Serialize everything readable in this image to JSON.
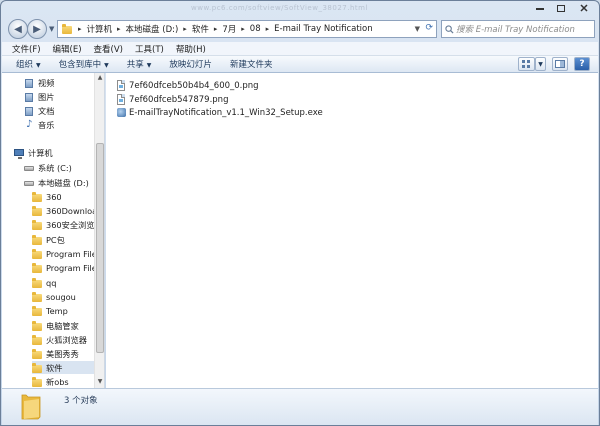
{
  "watermark": "www.pc6.com/softview/SoftView_38027.html",
  "address": {
    "crumbs": [
      "计算机",
      "本地磁盘 (D:)",
      "软件",
      "7月",
      "08",
      "E-mail Tray Notification"
    ],
    "separator": "▸"
  },
  "search": {
    "placeholder": "搜索 E-mail Tray Notification"
  },
  "menu": [
    "文件(F)",
    "编辑(E)",
    "查看(V)",
    "工具(T)",
    "帮助(H)"
  ],
  "toolbar": {
    "organize": "组织",
    "include": "包含到库中",
    "share": "共享",
    "slideshow": "放映幻灯片",
    "new_folder": "新建文件夹"
  },
  "nav": {
    "libraries": [
      "视频",
      "图片",
      "文档",
      "音乐"
    ],
    "computer": "计算机",
    "drives": [
      "系统 (C:)",
      "本地磁盘 (D:)"
    ],
    "folders": [
      "360",
      "360Download",
      "360安全浏览器",
      "PC包",
      "Program Files",
      "Program Files",
      "qq",
      "sougou",
      "Temp",
      "电脑管家",
      "火狐浏览器",
      "美图秀秀",
      "软件",
      "新obs"
    ],
    "selected_folder": "软件"
  },
  "files": [
    {
      "name": "7ef60dfceb50b4b4_600_0.png",
      "icon": "image-file-icon"
    },
    {
      "name": "7ef60dfceb547879.png",
      "icon": "image-file-icon"
    },
    {
      "name": "E-mailTrayNotification_v1.1_Win32_Setup.exe",
      "icon": "exe-file-icon"
    }
  ],
  "status": {
    "count_text": "3 个对象"
  },
  "colors": {
    "accent": "#3d6fb0",
    "selection": "#d9e4f1"
  }
}
